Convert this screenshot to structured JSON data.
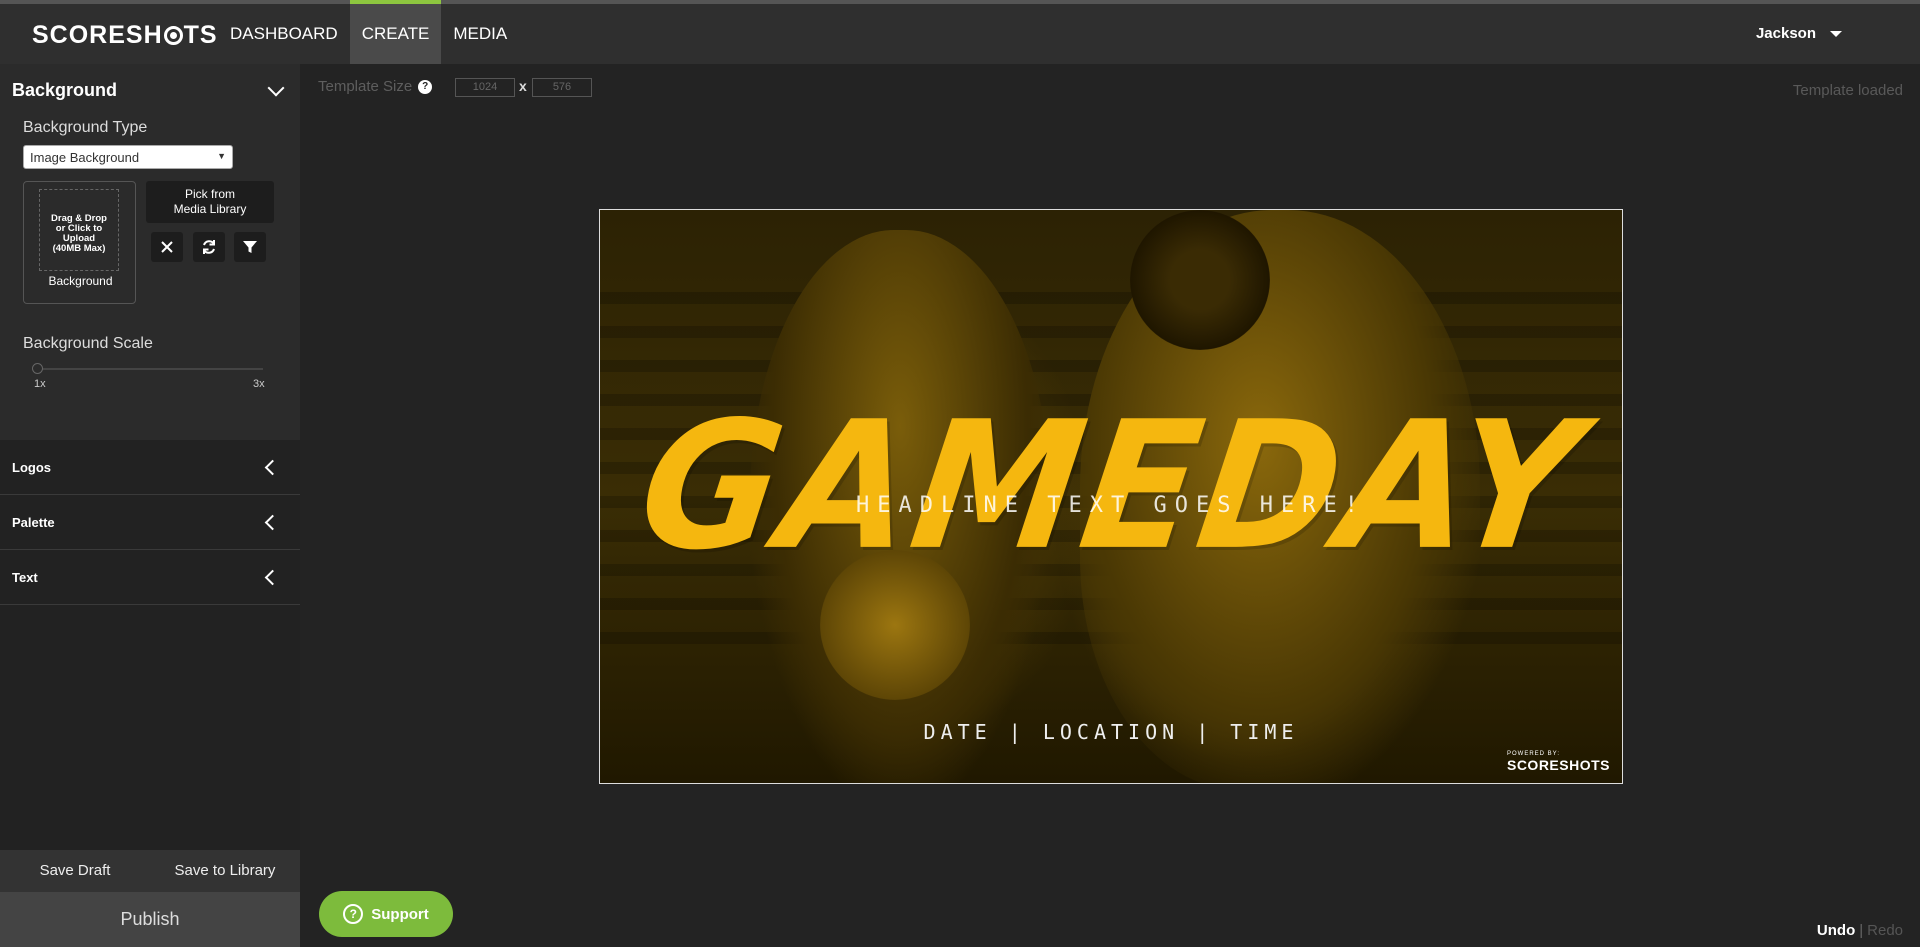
{
  "app": {
    "logo": "SCORESH",
    "logo_suffix": "TS"
  },
  "nav": {
    "items": [
      {
        "label": "DASHBOARD"
      },
      {
        "label": "CREATE"
      },
      {
        "label": "MEDIA"
      }
    ],
    "user": "Jackson"
  },
  "sidebar": {
    "background": {
      "title": "Background",
      "type_label": "Background Type",
      "type_value": "Image Background",
      "upload_text_1": "Drag & Drop",
      "upload_text_2": "or Click to Upload",
      "upload_text_3": "(40MB Max)",
      "upload_label": "Background",
      "pick_line1": "Pick from",
      "pick_line2": "Media Library",
      "scale_label": "Background Scale",
      "scale_min": "1x",
      "scale_max": "3x",
      "scale_value": 1
    },
    "sections": [
      {
        "label": "Logos"
      },
      {
        "label": "Palette"
      },
      {
        "label": "Text"
      }
    ],
    "save_draft": "Save Draft",
    "save_library": "Save to Library",
    "publish": "Publish"
  },
  "canvas": {
    "template_size_label": "Template Size",
    "width_value": "1024",
    "height_value": "576",
    "x_sep": "x",
    "status": "Template loaded",
    "gameday": "GAMEDAY",
    "headline": "HEADLINE TEXT GOES HERE!",
    "date_line": "DATE | LOCATION | TIME",
    "powered_by": "POWERED BY:",
    "powered_logo": "SCORESHOTS",
    "accent_color": "#f5b70f"
  },
  "footer": {
    "support": "Support",
    "undo": "Undo",
    "separator": "|",
    "redo": "Redo"
  },
  "colors": {
    "brand_green": "#8dc63f",
    "support_green": "#7dbb3c"
  }
}
